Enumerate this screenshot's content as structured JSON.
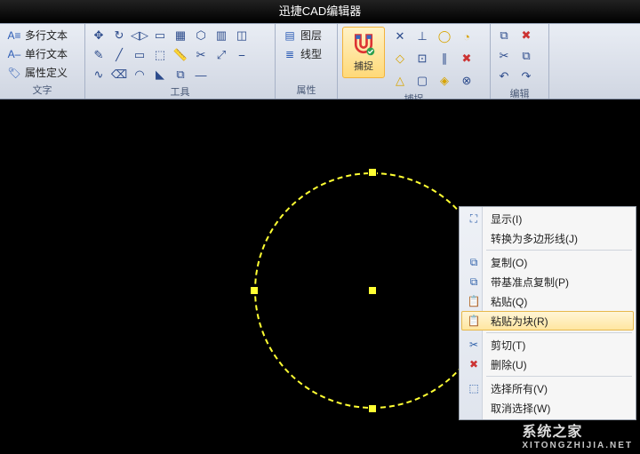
{
  "app": {
    "title": "迅捷CAD编辑器"
  },
  "ribbon": {
    "text": {
      "label": "文字",
      "items": {
        "multiline": "多行文本",
        "singleline": "单行文本",
        "attrdef": "属性定义"
      }
    },
    "tools": {
      "label": "工具",
      "icons": {
        "move": "✥",
        "rotate": "↻",
        "mirror": "◁▷",
        "scale": "▭",
        "rectarray": "▦",
        "polararray": "⬡",
        "arraypath": "▥",
        "offset": "◫",
        "pencil": "✎",
        "line": "╱",
        "rect": "▭",
        "sel": "⬚",
        "measure": "📏",
        "trim": "✂",
        "extend": "⤢",
        "break": "⎯",
        "pline": "∿",
        "erase": "⌫",
        "fillet": "◠",
        "chamfer": "◣",
        "copy": "⧉",
        "line2": "―"
      }
    },
    "props": {
      "label": "属性",
      "layer": "图层",
      "ltype": "线型"
    },
    "snap": {
      "label": "捕捉",
      "big": "捕捉",
      "icons": {
        "endpoint": "✕",
        "perp": "⊥",
        "circle": "◯",
        "tangent": "◔",
        "quadrant": "◇",
        "node": "⊡",
        "parallel": "∥",
        "clear": "✖",
        "tri": "△",
        "mid": "▢",
        "rhom": "◈",
        "int": "⊗"
      }
    },
    "edit": {
      "label": "编辑",
      "icons": {
        "copy": "⧉",
        "del": "✖",
        "cut": "✂",
        "paste": "⧉",
        "undo": "↶",
        "redo": "↷"
      }
    }
  },
  "ctx": {
    "display": "显示(I)",
    "topline": "转换为多边形线(J)",
    "copy": "复制(O)",
    "copybase": "带基准点复制(P)",
    "paste": "粘贴(Q)",
    "pasteblock": "粘贴为块(R)",
    "cut": "剪切(T)",
    "delete": "删除(U)",
    "selectall": "选择所有(V)",
    "deselect": "取消选择(W)"
  },
  "watermark": {
    "main": "系统之家",
    "sub": "XITONGZHIJIA.NET"
  },
  "colors": {
    "select": "#ffff33"
  }
}
